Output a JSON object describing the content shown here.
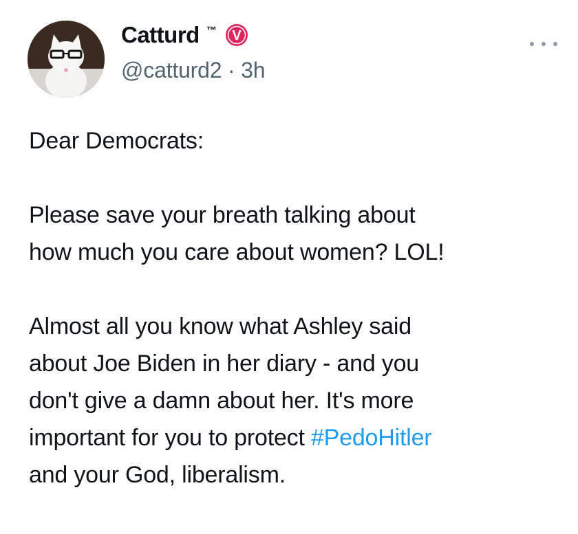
{
  "author": {
    "display_name": "Catturd",
    "trademark": "™",
    "badge_letter": "V",
    "badge_color": "#e0245e",
    "handle": "@catturd2",
    "separator": " · ",
    "time_ago": "3h"
  },
  "menu": {
    "more_icon": "more-horizontal-icon"
  },
  "tweet": {
    "line1": "Dear Democrats:",
    "para2_line1": "Please save your breath talking about",
    "para2_line2": "how much you care about women? LOL!",
    "para3_line1": "Almost all you know what Ashley said",
    "para3_line2": "about Joe Biden in her diary - and you",
    "para3_line3": "don't give a damn about her. It's more",
    "para3_line4_start": "important for you to protect ",
    "hashtag": "#PedoHitler",
    "para3_line5": "and your God, liberalism."
  },
  "colors": {
    "text": "#0f1419",
    "secondary": "#536471",
    "link": "#1d9bf0"
  }
}
